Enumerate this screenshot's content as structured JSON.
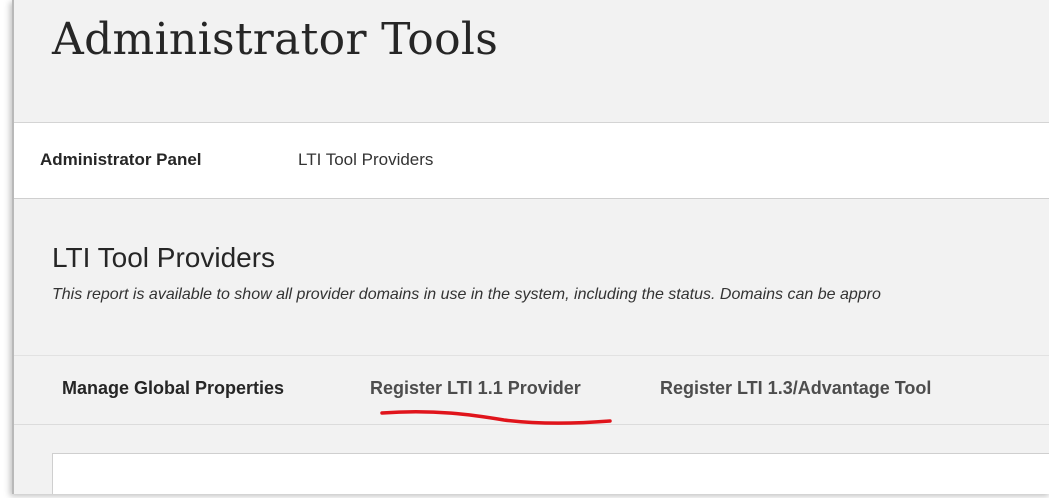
{
  "header": {
    "title": "Administrator Tools"
  },
  "breadcrumb": {
    "items": [
      {
        "label": "Administrator Panel"
      },
      {
        "label": "LTI Tool Providers"
      }
    ]
  },
  "main": {
    "title": "LTI Tool Providers",
    "description": "This report is available to show all provider domains in use in the system, including the status. Domains can be appro"
  },
  "toolbar": {
    "tabs": [
      {
        "label": "Manage Global Properties"
      },
      {
        "label": "Register LTI 1.1 Provider"
      },
      {
        "label": "Register LTI 1.3/Advantage Tool"
      }
    ]
  },
  "annotation": {
    "color": "#e0141b"
  }
}
